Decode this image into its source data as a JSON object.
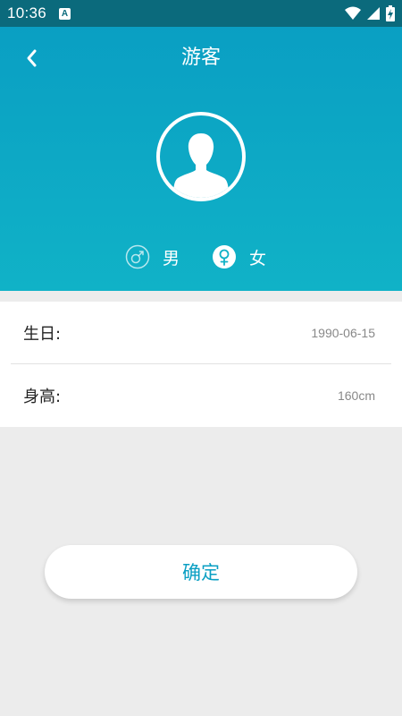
{
  "status_bar": {
    "time": "10:36",
    "notification_icon": "a-letter-icon",
    "icons": [
      "wifi-icon",
      "signal-icon",
      "battery-charging-icon"
    ]
  },
  "header": {
    "title": "游客",
    "back_icon": "chevron-left-icon",
    "avatar_icon": "user-silhouette-icon"
  },
  "gender": {
    "male_label": "男",
    "female_label": "女",
    "male_icon": "male-symbol-icon",
    "female_icon": "female-symbol-icon",
    "selected": "female"
  },
  "info": {
    "birthday_label": "生日:",
    "birthday_value": "1990-06-15",
    "height_label": "身高:",
    "height_value": "160cm"
  },
  "confirm_label": "确定",
  "colors": {
    "accent": "#0a9fc3",
    "header_bottom": "#10b2c7",
    "status_bar": "#0b6a7c",
    "background": "#ececec"
  }
}
